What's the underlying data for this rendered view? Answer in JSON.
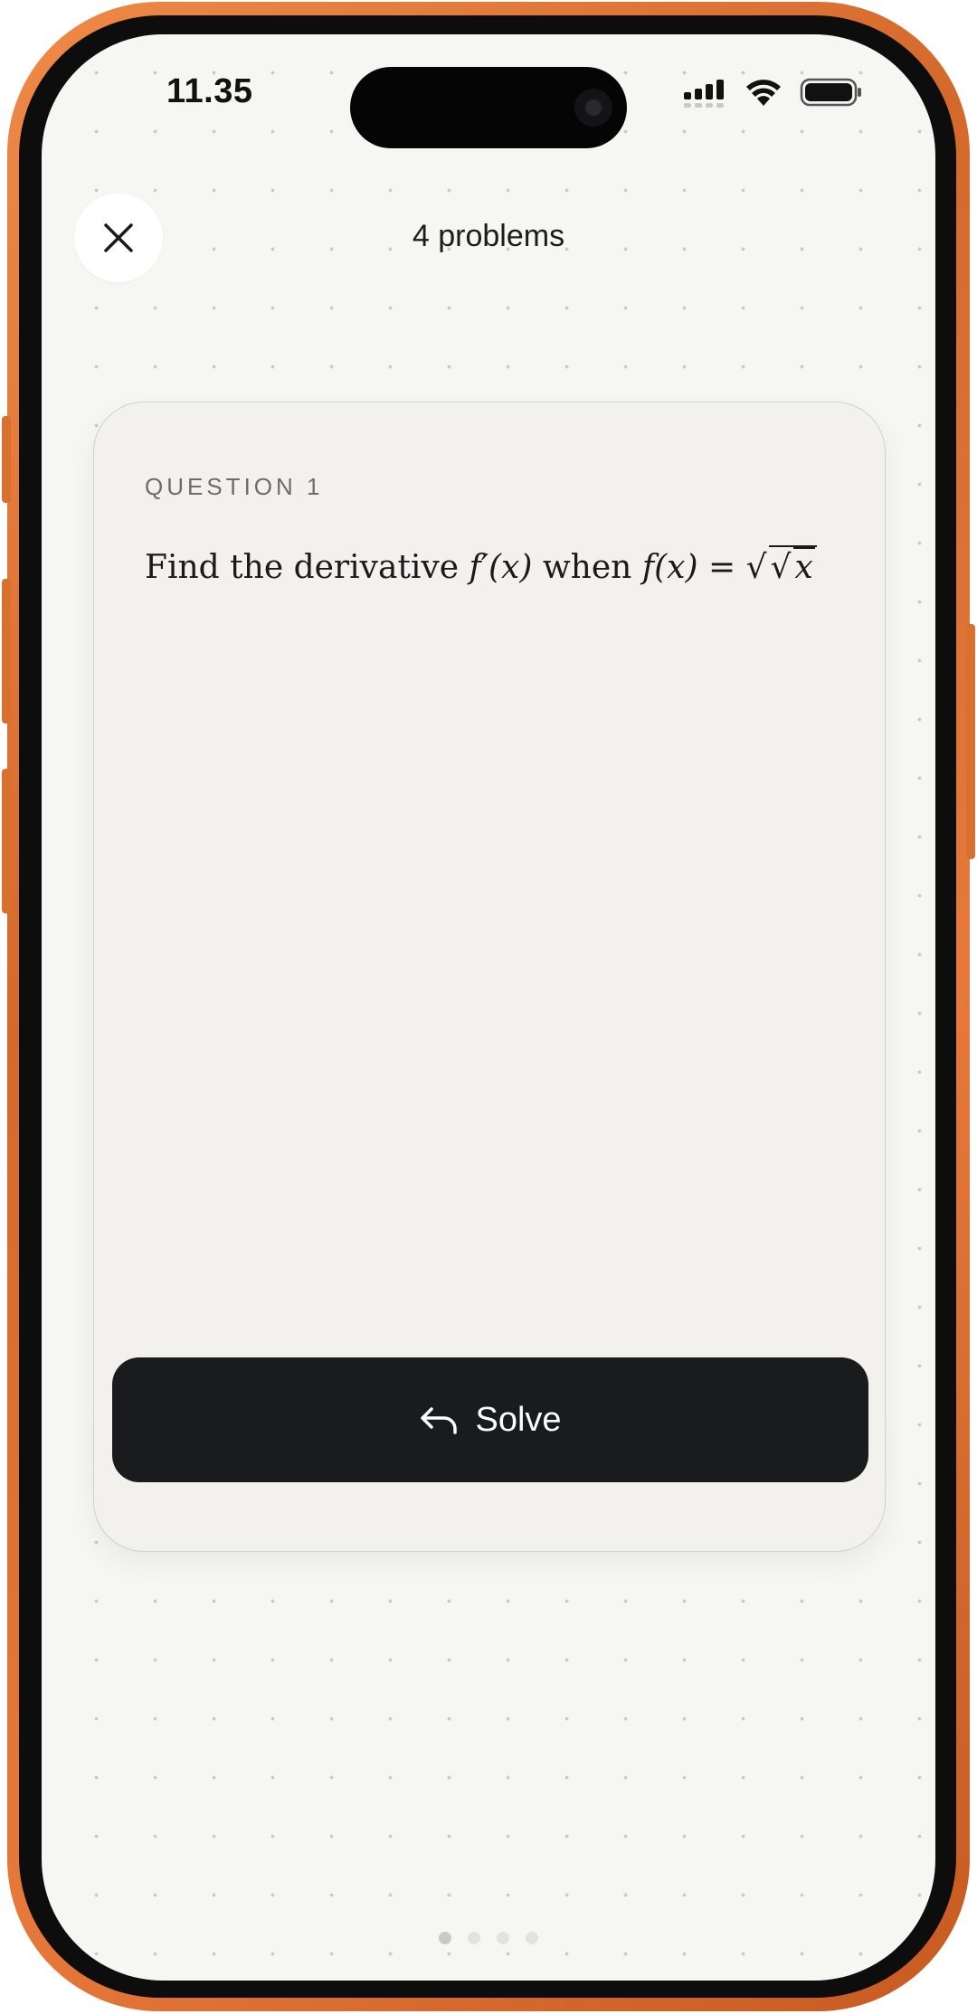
{
  "status_bar": {
    "time": "11.35",
    "icons": [
      "signal-icon",
      "wifi-icon",
      "battery-icon"
    ]
  },
  "header": {
    "close_icon": "close-icon",
    "title": "4 problems"
  },
  "card": {
    "label": "QUESTION 1",
    "question_prefix": "Find the derivative",
    "question_fx_prime": "f′(x)",
    "question_when": "when",
    "question_fx": "f(x) =",
    "question_radicand": "x"
  },
  "solve_button": {
    "icon": "reply-arrow-icon",
    "label": "Solve"
  },
  "pagination": {
    "total": 4,
    "current": 1
  },
  "colors": {
    "frame": "#e6793a",
    "background": "#f6f6f3",
    "card": "#f2f1ed",
    "button": "#1a1b1d"
  }
}
